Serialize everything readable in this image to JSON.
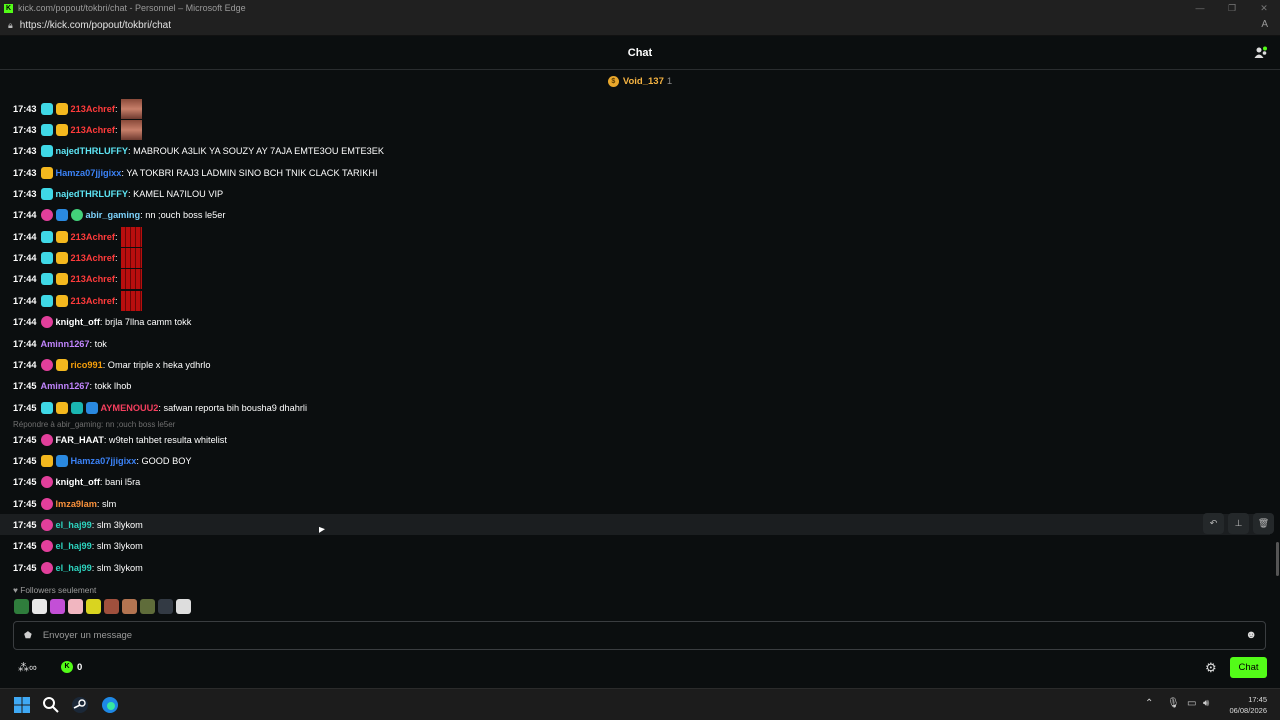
{
  "window": {
    "title": "kick.com/popout/tokbri/chat - Personnel – Microsoft Edge",
    "url": "https://kick.com/popout/tokbri/chat"
  },
  "header": {
    "title": "Chat"
  },
  "pinned": {
    "user": "Void_137",
    "count": "1"
  },
  "colors": {
    "accent": "#53fc18",
    "bg": "#0b0e0f",
    "highlight": "#1b1e20"
  },
  "messages": [
    {
      "time": "17:43",
      "badges": [
        "sub",
        "crown"
      ],
      "user": "213Achref",
      "user_color": "#ff3b3b",
      "text": ":",
      "emote": "face"
    },
    {
      "time": "17:43",
      "badges": [
        "sub",
        "crown"
      ],
      "user": "213Achref",
      "user_color": "#ff3b3b",
      "text": ":",
      "emote": "face"
    },
    {
      "time": "17:43",
      "badges": [
        "sub"
      ],
      "user": "najedTHRLUFFY",
      "user_color": "#5ee6f5",
      "text": ": MABROUK A3LIK YA SOUZY AY 7AJA EMTE3OU EMTE3EK"
    },
    {
      "time": "17:43",
      "badges": [
        "crown"
      ],
      "user": "Hamza07jjigixx",
      "user_color": "#3b82f6",
      "text": ": YA TOKBRI RAJ3 LADMIN SINO BCH TNIK CLACK TARIKHI"
    },
    {
      "time": "17:43",
      "badges": [
        "sub"
      ],
      "user": "najedTHRLUFFY",
      "user_color": "#5ee6f5",
      "text": ": KAMEL NA7ILOU VIP"
    },
    {
      "time": "17:44",
      "badges": [
        "pink",
        "blue",
        "green"
      ],
      "user": "abir_gaming",
      "user_color": "#7dd3fc",
      "text": ": nn ;ouch boss le5er"
    },
    {
      "time": "17:44",
      "badges": [
        "sub",
        "crown"
      ],
      "user": "213Achref",
      "user_color": "#ff3b3b",
      "text": ":",
      "emote": "red"
    },
    {
      "time": "17:44",
      "badges": [
        "sub",
        "crown"
      ],
      "user": "213Achref",
      "user_color": "#ff3b3b",
      "text": ":",
      "emote": "red"
    },
    {
      "time": "17:44",
      "badges": [
        "sub",
        "crown"
      ],
      "user": "213Achref",
      "user_color": "#ff3b3b",
      "text": ":",
      "emote": "red"
    },
    {
      "time": "17:44",
      "badges": [
        "sub",
        "crown"
      ],
      "user": "213Achref",
      "user_color": "#ff3b3b",
      "text": ":",
      "emote": "red"
    },
    {
      "time": "17:44",
      "badges": [
        "pink"
      ],
      "user": "knight_off",
      "user_color": "#ffffff",
      "text": ": brjla 7llna camm tokk"
    },
    {
      "time": "17:44",
      "badges": [],
      "user": "Aminn1267",
      "user_color": "#c084fc",
      "text": ": tok"
    },
    {
      "time": "17:44",
      "badges": [
        "pink",
        "crown"
      ],
      "user": "rico991",
      "user_color": "#f59e0b",
      "text": ": Omar triple x heka ydhrlo"
    },
    {
      "time": "17:45",
      "badges": [],
      "user": "Aminn1267",
      "user_color": "#c084fc",
      "text": ": tokk lhob"
    },
    {
      "time": "17:45",
      "badges": [
        "sub",
        "crown",
        "teal",
        "blue"
      ],
      "user": "AYMENOUU2",
      "user_color": "#f43f5e",
      "text": ": safwan reporta bih bousha9 dhahrli"
    },
    {
      "time": "17:45",
      "badges": [
        "pink"
      ],
      "user": "FAR_HAAT",
      "user_color": "#ffffff",
      "text": ": w9teh tahbet resulta whitelist"
    },
    {
      "time": "17:45",
      "badges": [
        "crown",
        "blue"
      ],
      "user": "Hamza07jjigixx",
      "user_color": "#3b82f6",
      "text": ": GOOD BOY"
    },
    {
      "time": "17:45",
      "badges": [
        "pink"
      ],
      "user": "knight_off",
      "user_color": "#ffffff",
      "text": ": bani l5ra"
    },
    {
      "time": "17:45",
      "badges": [
        "pink"
      ],
      "user": "lmza9lam",
      "user_color": "#fb923c",
      "text": ": slm"
    },
    {
      "time": "17:45",
      "badges": [
        "pink"
      ],
      "user": "el_haj99",
      "user_color": "#2dd4bf",
      "text": ": slm 3lykom",
      "highlight": true
    },
    {
      "time": "17:45",
      "badges": [
        "pink"
      ],
      "user": "el_haj99",
      "user_color": "#2dd4bf",
      "text": ": slm 3lykom"
    },
    {
      "time": "17:45",
      "badges": [
        "pink"
      ],
      "user": "el_haj99",
      "user_color": "#2dd4bf",
      "text": ": slm 3lykom"
    }
  ],
  "reply_preview": "Répondre à abir_gaming: nn ;ouch boss le5er",
  "followers_label": "Followers seulement",
  "input": {
    "placeholder": "Envoyer un message"
  },
  "bottom": {
    "kick_count": "0",
    "chat_button": "Chat"
  },
  "clock": {
    "time": "17:45",
    "date": "06/08/2026"
  }
}
